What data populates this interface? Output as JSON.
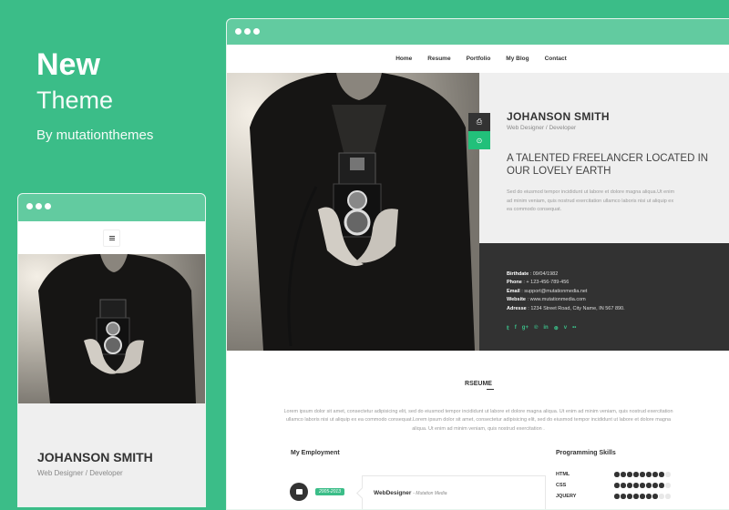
{
  "promo": {
    "headline": "New",
    "subheadline": "Theme",
    "author": "By mutationthemes"
  },
  "colors": {
    "background": "#3bbd88",
    "browser_bar": "#62cba0",
    "accent": "#22c07a",
    "dark": "#323232"
  },
  "desktop": {
    "nav": [
      "Home",
      "Resume",
      "Portfolio",
      "My Blog",
      "Contact"
    ],
    "side_buttons": [
      {
        "icon": "printer-icon",
        "glyph": "⎙"
      },
      {
        "icon": "download-icon",
        "glyph": "⊙"
      }
    ],
    "profile": {
      "name": "JOHANSON SMITH",
      "role": "Web Designer / Developer",
      "tagline": "A TALENTED FREELANCER LOCATED IN OUR LOVELY EARTH",
      "blurb": "Sed do eiusmod tempor incididunt ut labore et dolore magna aliqua.Ut enim ad minim veniam, quis nostrud exercitation ullamco laboris nisi ut aliquip ex ea commodo consequat."
    },
    "contact": [
      {
        "label": "Birthdate",
        "value": "09/04/1982"
      },
      {
        "label": "Phone",
        "value": "+ 123-456-789-456"
      },
      {
        "label": "Email",
        "value": "support@mutationmedia.net"
      },
      {
        "label": "Website",
        "value": "www.mutationmedia.com"
      },
      {
        "label": "Adresse",
        "value": "1234 Street Road, City Name, IN 567 890."
      }
    ],
    "social": [
      {
        "name": "twitter-icon",
        "glyph": "𝕥"
      },
      {
        "name": "facebook-icon",
        "glyph": "f"
      },
      {
        "name": "google-plus-icon",
        "glyph": "g+"
      },
      {
        "name": "pinterest-icon",
        "glyph": "℗"
      },
      {
        "name": "linkedin-icon",
        "glyph": "in"
      },
      {
        "name": "dribbble-icon",
        "glyph": "⊛"
      },
      {
        "name": "vimeo-icon",
        "glyph": "v"
      },
      {
        "name": "flickr-icon",
        "glyph": "••"
      }
    ],
    "resume": {
      "title": "RSEUME",
      "text": "Lorem ipsum dolor sit amet, consectetur adipisicing elit, sed do eiusmod tempor incididunt ut labore et dolore magna aliqua. Ut enim ad minim veniam, quis nostrud exercitation ullamco laboris nisi ut aliquip ex ea commodo consequat.Lorem ipsum dolor sit amet, consectetur adipisicing elit, sed do eiusmod tempor incididunt ut labore et dolore magna aliqua. Ut enim ad minim veniam, quis nostrud exercitation ."
    },
    "employment": {
      "title": "My Employment",
      "items": [
        {
          "dates": "2005-2013",
          "position": "WebDesigner",
          "company": "- Mutation Media"
        }
      ]
    },
    "skills": {
      "title": "Programming Skills",
      "max": 9,
      "items": [
        {
          "name": "HTML",
          "level": 8
        },
        {
          "name": "CSS",
          "level": 8
        },
        {
          "name": "JQUERY",
          "level": 7
        }
      ]
    }
  },
  "mobile": {
    "menu_icon": "hamburger-menu-icon",
    "name": "JOHANSON SMITH",
    "role": "Web Designer / Developer"
  }
}
